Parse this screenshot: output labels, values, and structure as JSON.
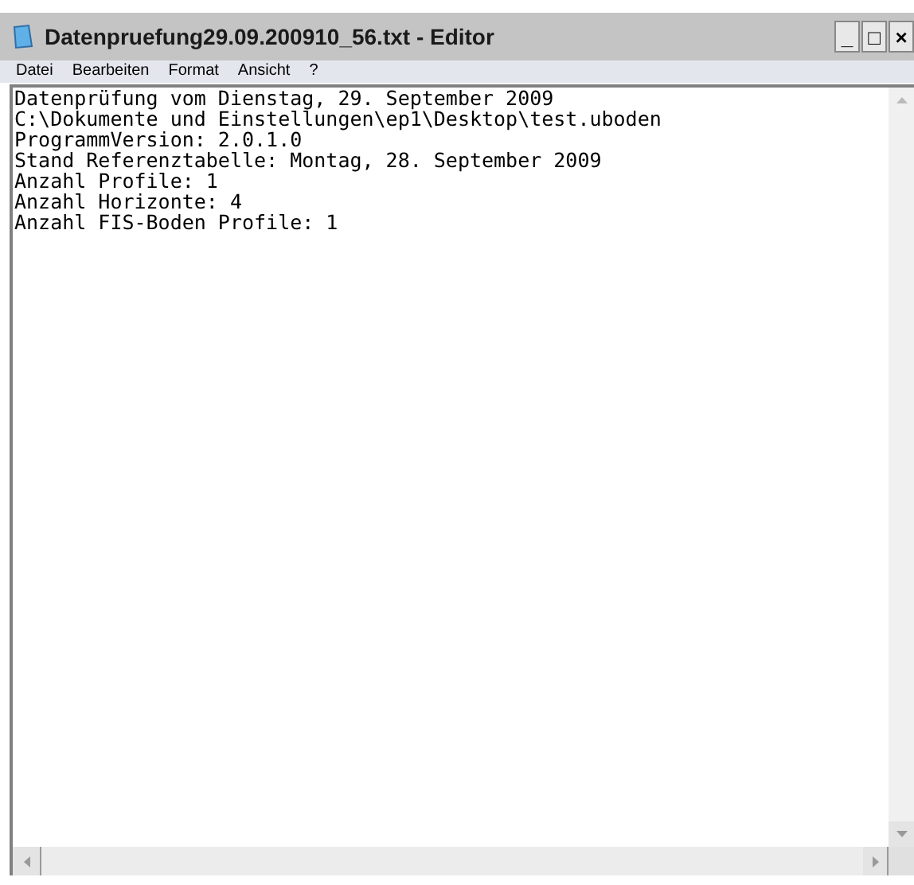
{
  "window": {
    "title": "Datenpruefung29.09.200910_56.txt - Editor"
  },
  "title_buttons": [
    "_",
    "□",
    "×"
  ],
  "menu": [
    "Datei",
    "Bearbeiten",
    "Format",
    "Ansicht",
    "?"
  ],
  "editor": {
    "lines": [
      "Datenprüfung vom Dienstag, 29. September 2009",
      "C:\\Dokumente und Einstellungen\\ep1\\Desktop\\test.uboden",
      "ProgrammVersion: 2.0.1.0",
      "Stand Referenztabelle: Montag, 28. September 2009",
      "Anzahl Profile: 1",
      "Anzahl Horizonte: 4",
      "Anzahl FIS-Boden Profile: 1"
    ]
  }
}
